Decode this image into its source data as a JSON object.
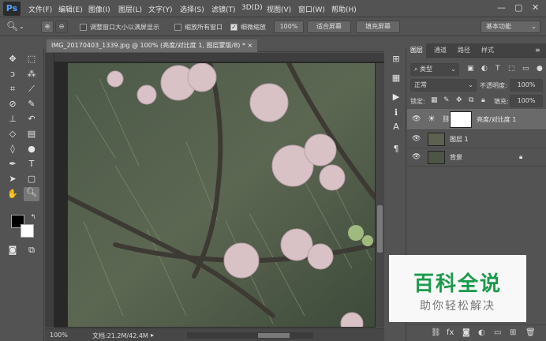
{
  "app": {
    "logo": "Ps"
  },
  "menu": [
    "文件(F)",
    "编辑(E)",
    "图像(I)",
    "图层(L)",
    "文字(Y)",
    "选择(S)",
    "滤镜(T)",
    "3D(D)",
    "视图(V)",
    "窗口(W)",
    "帮助(H)"
  ],
  "window_controls": {
    "minimize": "—",
    "restore": "▢",
    "close": "✕"
  },
  "options": {
    "resize_windows": "调整窗口大小以满屏显示",
    "zoom_all_windows": "缩放所有窗口",
    "scrubby_zoom": "细微缩放",
    "zoom_value": "100%",
    "fit_screen": "适合屏幕",
    "fill_screen": "填充屏幕",
    "workspace": "基本功能"
  },
  "document": {
    "tab_title": "IMG_20170403_1339.jpg @ 100% (亮度/对比度 1, 图层蒙版/8) *",
    "tab_close": "×",
    "zoom": "100%",
    "doc_size": "文档:21.2M/42.4M"
  },
  "layers_panel": {
    "tabs": [
      "图层",
      "通道",
      "路径",
      "样式"
    ],
    "filter_kind": "类型",
    "blend_mode": "正常",
    "opacity_label": "不透明度:",
    "opacity_value": "100%",
    "lock_label": "锁定:",
    "fill_label": "填充:",
    "fill_value": "100%",
    "layers": [
      {
        "name": "亮度/对比度 1",
        "visible": true,
        "selected": true
      },
      {
        "name": "图层 1",
        "visible": true,
        "selected": false
      },
      {
        "name": "背景",
        "visible": true,
        "selected": false,
        "locked": true
      }
    ]
  },
  "watermark": {
    "title": "百科全说",
    "subtitle": "助你轻松解决"
  },
  "colors": {
    "ui_bg": "#535353",
    "selected_layer": "#6a6a6a",
    "watermark_green": "#1a9a4a"
  }
}
